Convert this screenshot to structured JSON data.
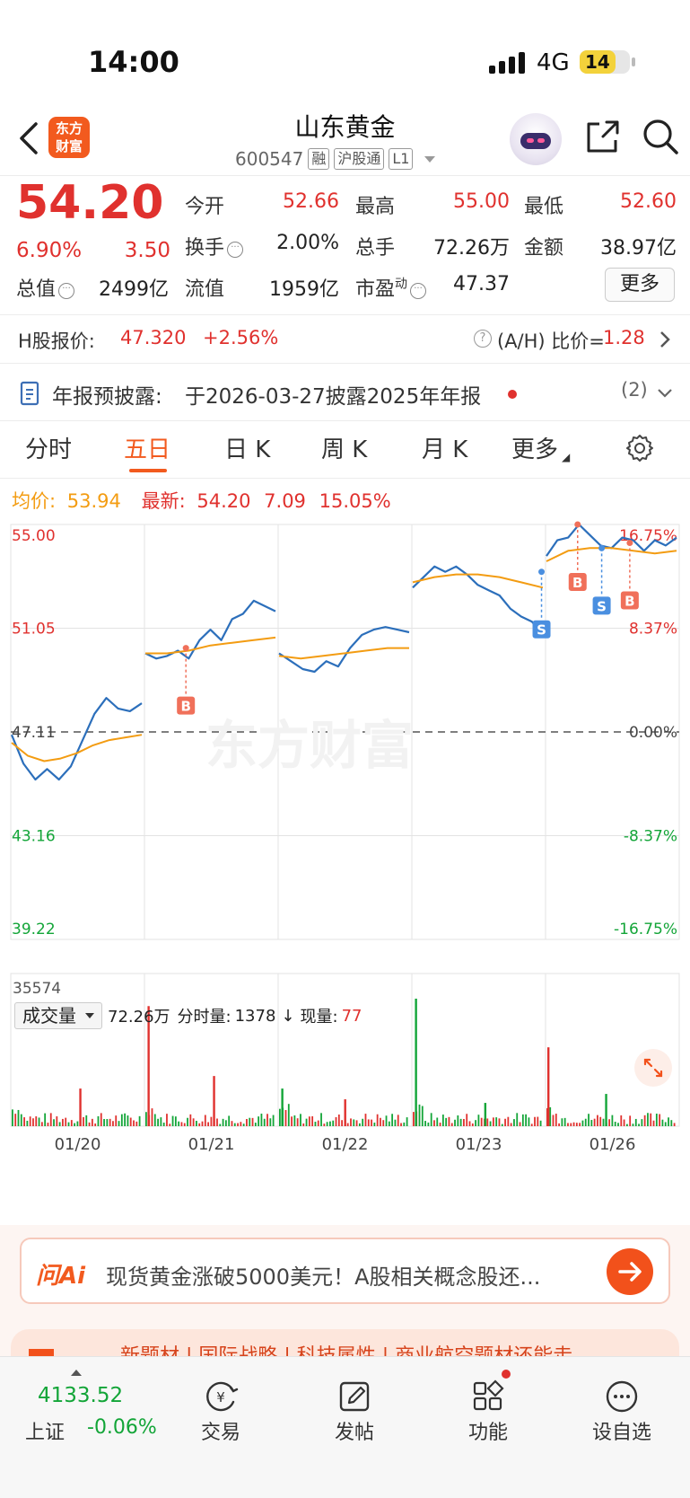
{
  "status_bar": {
    "time": "14:00",
    "network": "4G",
    "battery": "14"
  },
  "header": {
    "logo_text_1": "东方",
    "logo_text_2": "财富",
    "stock_name": "山东黄金",
    "stock_code": "600547",
    "tags": [
      "融",
      "沪股通",
      "L1"
    ]
  },
  "quote": {
    "price": "54.20",
    "change_pct": "6.90%",
    "change": "3.50",
    "open_label": "今开",
    "open": "52.66",
    "high_label": "最高",
    "high": "55.00",
    "low_label": "最低",
    "low": "52.60",
    "turnover_label": "换手",
    "turnover": "2.00%",
    "volume_label": "总手",
    "volume": "72.26万",
    "amount_label": "金额",
    "amount": "38.97亿",
    "mktcap_label": "总值",
    "mktcap": "2499亿",
    "float_label": "流值",
    "float": "1959亿",
    "pe_label": "市盈",
    "pe_sup": "动",
    "pe": "47.37",
    "more_button": "更多"
  },
  "h_share": {
    "label": "H股报价:",
    "price": "47.320",
    "change": "+2.56%",
    "ratio_label": "(A/H) 比价=",
    "ratio": "1.28"
  },
  "notice": {
    "label": "年报预披露:",
    "text": "于2026-03-27披露2025年年报",
    "count": "(2)"
  },
  "tabs": [
    "分时",
    "五日",
    "日 K",
    "周 K",
    "月 K",
    "更多"
  ],
  "active_tab": "五日",
  "avg_bar": {
    "avg_label": "均价:",
    "avg": "53.94",
    "latest_label": "最新:",
    "latest": "54.20",
    "latest_chg": "7.09",
    "latest_pct": "15.05%"
  },
  "watermark": "东方财富",
  "chart_data": {
    "type": "line",
    "title": "",
    "x": [
      "01/20",
      "01/21",
      "01/22",
      "01/23",
      "01/26"
    ],
    "y_ticks_left": [
      "55.00",
      "51.05",
      "47.11",
      "43.16",
      "39.22"
    ],
    "y_ticks_right": [
      "16.75%",
      "8.37%",
      "0.00%",
      "-8.37%",
      "-16.75%"
    ],
    "ylim": [
      39.22,
      55.0
    ],
    "prev_close": 47.11,
    "series": [
      {
        "name": "price",
        "days": [
          [
            47.0,
            45.9,
            45.3,
            45.7,
            45.3,
            45.8,
            46.8,
            47.8,
            48.4,
            48.0,
            47.9,
            48.2
          ],
          [
            50.1,
            49.9,
            50.0,
            50.2,
            49.9,
            50.6,
            51.0,
            50.6,
            51.4,
            51.6,
            52.1,
            51.9,
            51.7
          ],
          [
            50.1,
            49.8,
            49.5,
            49.4,
            49.8,
            49.6,
            50.3,
            50.8,
            51.0,
            51.1,
            51.0,
            50.9
          ],
          [
            52.6,
            53.0,
            53.4,
            53.2,
            53.4,
            53.1,
            52.7,
            52.5,
            52.3,
            51.8,
            51.5,
            51.3,
            50.8
          ],
          [
            53.8,
            54.4,
            54.5,
            55.0,
            54.6,
            54.2,
            54.1,
            54.5,
            54.4,
            54.0,
            54.4,
            54.2,
            54.5
          ]
        ]
      },
      {
        "name": "avg",
        "days": [
          [
            46.7,
            46.2,
            46.0,
            46.1,
            46.3,
            46.6,
            46.8,
            46.9,
            47.0
          ],
          [
            50.1,
            50.1,
            50.2,
            50.4,
            50.5,
            50.6,
            50.7
          ],
          [
            50.0,
            49.9,
            50.0,
            50.1,
            50.2,
            50.3,
            50.3
          ],
          [
            52.8,
            53.0,
            53.1,
            53.1,
            53.0,
            52.8,
            52.6
          ],
          [
            53.6,
            54.0,
            54.1,
            54.1,
            54.0,
            53.9,
            54.0
          ]
        ]
      }
    ],
    "trade_marks": [
      {
        "type": "B",
        "day": 1,
        "frac": 0.31,
        "price": 50.3
      },
      {
        "type": "S",
        "day": 3,
        "frac": 0.97,
        "price": 53.2
      },
      {
        "type": "B",
        "day": 4,
        "frac": 0.24,
        "price": 55.0
      },
      {
        "type": "S",
        "day": 4,
        "frac": 0.42,
        "price": 54.1
      },
      {
        "type": "B",
        "day": 4,
        "frac": 0.63,
        "price": 54.3
      }
    ],
    "volume": {
      "label": "成交量",
      "total": "72.26万",
      "tick_label": "分时量:",
      "tick": "1378",
      "arrow": "↓",
      "current_label": "现量:",
      "current": "77",
      "ymax_label": "35574",
      "ymax": 35574,
      "spikes": [
        {
          "day": 0,
          "frac": 0.52,
          "value": 10500,
          "color": "red"
        },
        {
          "day": 1,
          "frac": 0.01,
          "value": 33500,
          "color": "red"
        },
        {
          "day": 1,
          "frac": 0.52,
          "value": 14000,
          "color": "red"
        },
        {
          "day": 2,
          "frac": 0.01,
          "value": 10500,
          "color": "green"
        },
        {
          "day": 2,
          "frac": 0.5,
          "value": 7500,
          "color": "red"
        },
        {
          "day": 3,
          "frac": 0.01,
          "value": 35574,
          "color": "green"
        },
        {
          "day": 3,
          "frac": 0.55,
          "value": 6500,
          "color": "green"
        },
        {
          "day": 4,
          "frac": 0.0,
          "value": 22000,
          "color": "red"
        },
        {
          "day": 4,
          "frac": 0.45,
          "value": 9000,
          "color": "green"
        }
      ]
    },
    "colors": {
      "price": "#2c6fbb",
      "avg": "#f39c12",
      "up": "#e0312e",
      "down": "#13a538",
      "buy": "#f0705a",
      "sell": "#4a8fe0"
    }
  },
  "ai": {
    "logo": "问Ai",
    "text": "现货黄金涨破5000美元！A股相关概念股还..."
  },
  "promo": {
    "text": "新题材 | 国际战略 | 科技属性 | 商业航空题材还能走"
  },
  "bottom_nav": {
    "index_value": "4133.52",
    "index_name": "上证",
    "index_change": "-0.06%",
    "items": [
      "交易",
      "发帖",
      "功能",
      "设自选"
    ]
  }
}
